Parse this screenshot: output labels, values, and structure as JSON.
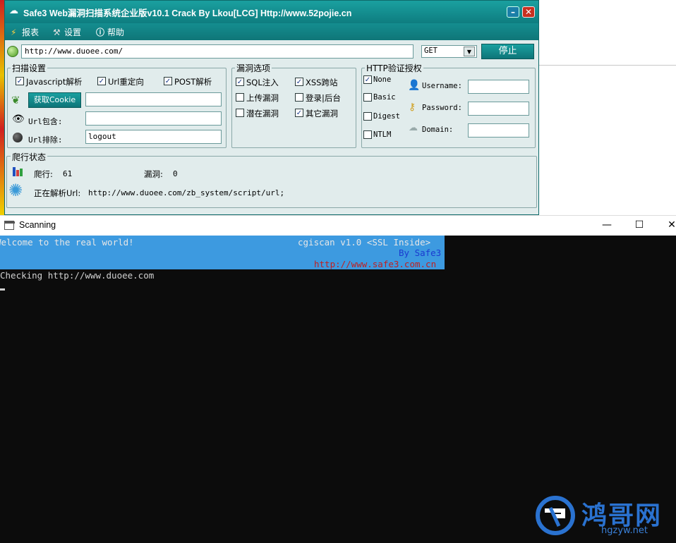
{
  "safe3": {
    "title": "Safe3 Web漏洞扫描系统企业版v10.1   Crack  By  Lkou[LCG]    Http://www.52pojie.cn",
    "menu": [
      "报表",
      "设置",
      "帮助"
    ],
    "url": "http://www.duoee.com/",
    "method": "GET",
    "stop_label": "停止",
    "scan_settings": {
      "title": "扫描设置",
      "javascript": "Javascript解析",
      "url_redirect": "Url重定向",
      "post_parse": "POST解析",
      "get_cookie": "获取Cookie",
      "url_include_label": "Url包含:",
      "url_exclude_label": "Url排除:",
      "url_exclude_value": "logout"
    },
    "vuln_options": {
      "title": "漏洞选项",
      "sql": "SQL注入",
      "xss": "XSS跨站",
      "upload": "上传漏洞",
      "login": "登录|后台",
      "latent": "潜在漏洞",
      "other": "其它漏洞"
    },
    "http_auth": {
      "title": "HTTP验证授权",
      "none": "None",
      "basic": "Basic",
      "digest": "Digest",
      "ntlm": "NTLM",
      "username": "Username:",
      "password": "Password:",
      "domain": "Domain:"
    },
    "crawl": {
      "title": "爬行状态",
      "crawled_label": "爬行:",
      "crawled_value": "61",
      "vuln_label": "漏洞:",
      "vuln_value": "0",
      "parsing_label": "正在解析Url:",
      "parsing_url": "http://www.duoee.com/zb_system/script/url;"
    }
  },
  "console": {
    "title": "Scanning",
    "banner_left": "Welcome to the real world!",
    "banner_right1": "cgiscan v1.0  <SSL Inside>",
    "banner_right2": "By Safe3",
    "banner_right3": "http://www.safe3.com.cn",
    "line": "Checking http://www.duoee.com"
  },
  "watermark": {
    "text": "鸿哥网",
    "sub": "hgzyw.net"
  },
  "colors": {
    "titlebar": "#0e7d80",
    "banner": "#3d9ae0",
    "console_bg": "#0c0c0c"
  }
}
